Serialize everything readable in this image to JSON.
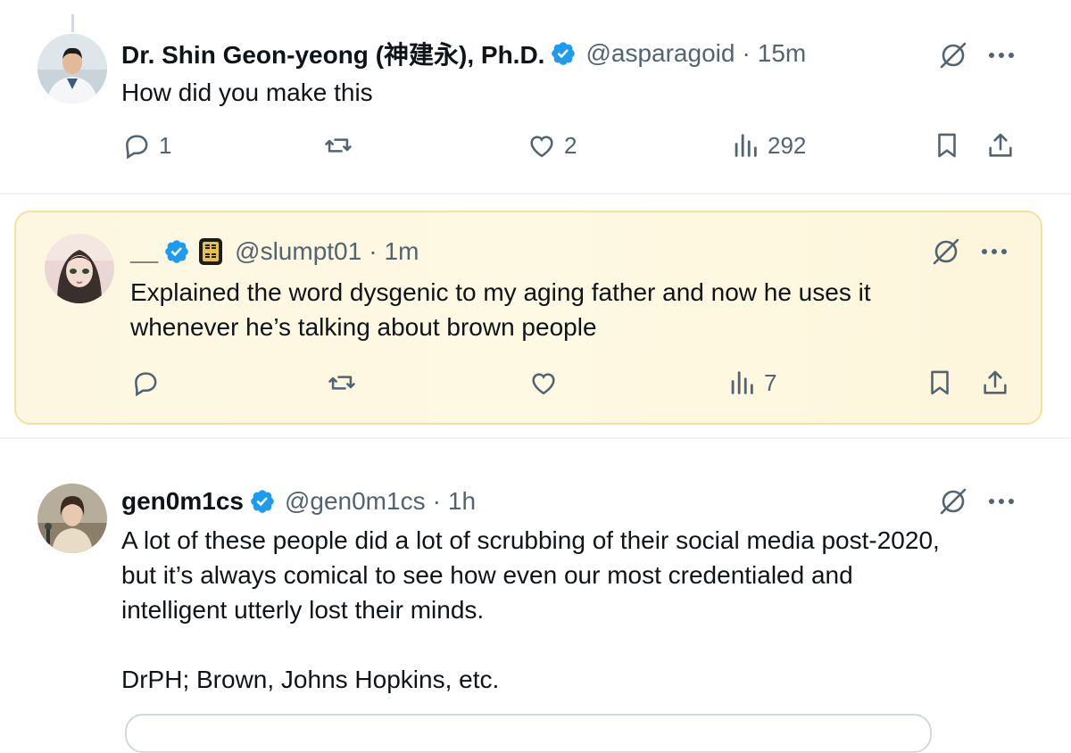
{
  "colors": {
    "accent": "#1d9bf0",
    "muted": "#536471",
    "highlight": "#fdf7e2"
  },
  "posts": [
    {
      "name": "Dr. Shin Geon-yeong (神建永), Ph.D.",
      "handle": "@asparagoid",
      "sep": "·",
      "time": "15m",
      "text": "How did you make this",
      "verified": true,
      "actions": {
        "replies": "1",
        "reposts": "",
        "likes": "2",
        "views": "292"
      },
      "icons": [
        "reply-icon",
        "repost-icon",
        "like-icon",
        "views-icon",
        "bookmark-icon",
        "share-icon",
        "grok-icon",
        "more-icon"
      ]
    },
    {
      "name": "__",
      "handle": "@slumpt01",
      "sep": "·",
      "time": "1m",
      "text": "Explained the word dysgenic to my aging father and now he uses it\nwhenever he’s talking about brown people",
      "verified": true,
      "affiliate_badge": "SO PO",
      "highlighted": true,
      "actions": {
        "replies": "",
        "reposts": "",
        "likes": "",
        "views": "7"
      }
    },
    {
      "name": "gen0m1cs",
      "handle": "@gen0m1cs",
      "sep": "·",
      "time": "1h",
      "text": "A lot of these people did a lot of scrubbing of their social media post-2020,\nbut it’s always comical to see how even our most credentialed and\nintelligent utterly lost their minds.\n\nDrPH; Brown, Johns Hopkins, etc.",
      "verified": true
    }
  ]
}
